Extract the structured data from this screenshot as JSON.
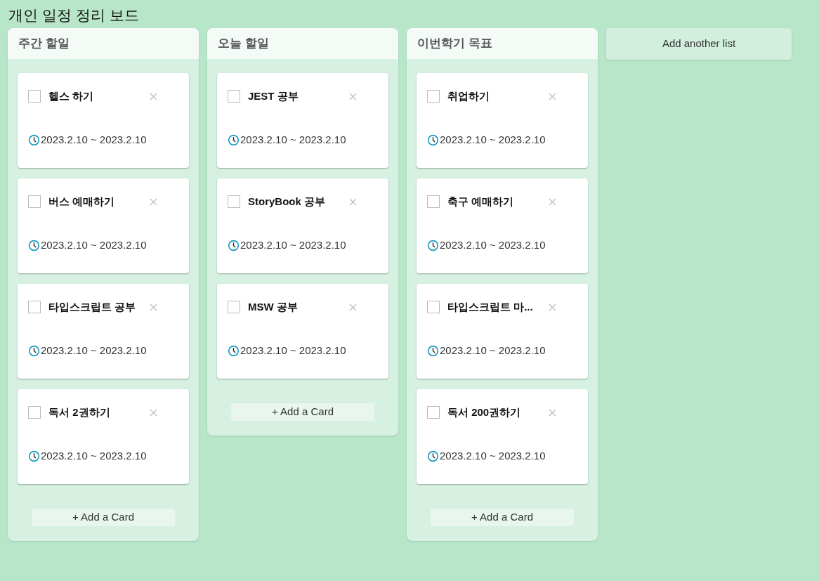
{
  "board": {
    "title": "개인 일정 정리 보드"
  },
  "lists": [
    {
      "title": "주간 할일",
      "cards": [
        {
          "title": "헬스 하기",
          "checked": false,
          "date": "2023.2.10 ~ 2023.2.10"
        },
        {
          "title": "버스 예매하기",
          "checked": false,
          "date": "2023.2.10 ~ 2023.2.10"
        },
        {
          "title": "타입스크립트 공부",
          "checked": false,
          "date": "2023.2.10 ~ 2023.2.10"
        },
        {
          "title": "독서 2권하기",
          "checked": false,
          "date": "2023.2.10 ~ 2023.2.10"
        }
      ],
      "add_button": "+ Add a Card"
    },
    {
      "title": "오늘 할일",
      "cards": [
        {
          "title": "JEST 공부",
          "checked": false,
          "date": "2023.2.10 ~ 2023.2.10"
        },
        {
          "title": "StoryBook 공부",
          "checked": false,
          "date": "2023.2.10 ~ 2023.2.10"
        },
        {
          "title": "MSW 공부",
          "checked": false,
          "date": "2023.2.10 ~ 2023.2.10"
        }
      ],
      "add_button": "+ Add a Card"
    },
    {
      "title": "이번학기 목표",
      "cards": [
        {
          "title": "취업하기",
          "checked": false,
          "date": "2023.2.10 ~ 2023.2.10"
        },
        {
          "title": "축구 예매하기",
          "checked": false,
          "date": "2023.2.10 ~ 2023.2.10"
        },
        {
          "title": "타입스크립트 마...",
          "checked": false,
          "date": "2023.2.10 ~ 2023.2.10"
        },
        {
          "title": "독서 200권하기",
          "checked": false,
          "date": "2023.2.10 ~ 2023.2.10"
        }
      ],
      "add_button": "+ Add a Card"
    }
  ],
  "add_list_button": "Add another list"
}
